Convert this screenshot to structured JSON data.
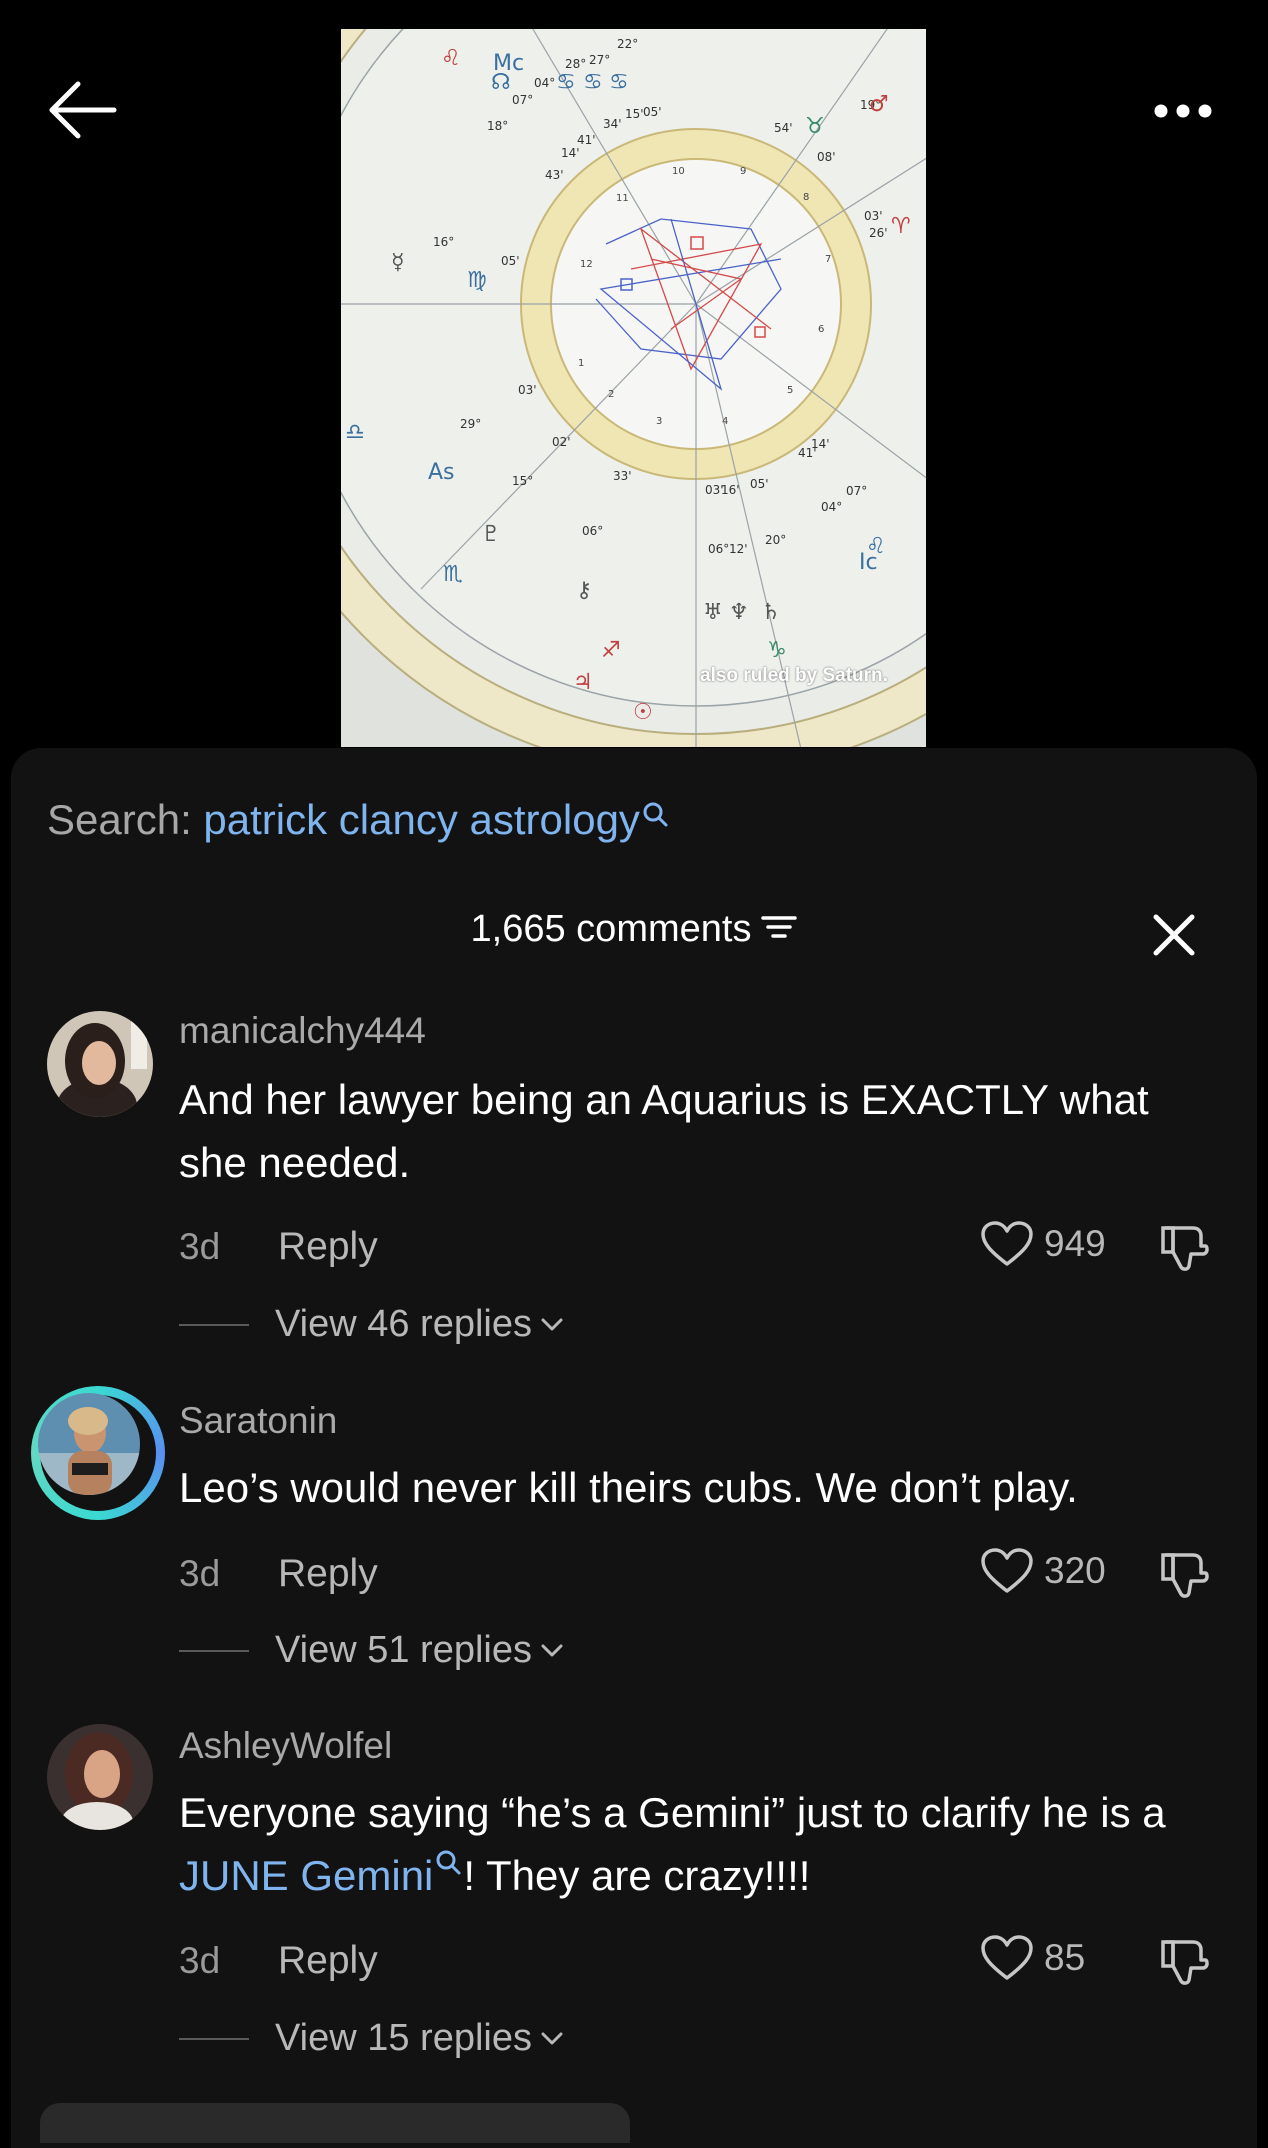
{
  "video": {
    "caption": "also ruled by Saturn.",
    "chart_degree_labels": [
      "28°",
      "27°",
      "22°",
      "04°",
      "07°",
      "18°",
      "34'",
      "15'",
      "05'",
      "41'",
      "14'",
      "43'",
      "16°",
      "05'",
      "03'",
      "29°",
      "02'",
      "15°",
      "33'",
      "06°",
      "03'",
      "16'",
      "05'",
      "06°",
      "12'",
      "20°",
      "54'",
      "08'",
      "19°",
      "03'",
      "26'",
      "14'",
      "41'",
      "07°",
      "04°"
    ],
    "house_numbers": [
      "1",
      "2",
      "3",
      "4",
      "5",
      "6",
      "7",
      "8",
      "9",
      "10",
      "11",
      "12"
    ]
  },
  "search": {
    "prefix": "Search:",
    "query": "patrick clancy astrology"
  },
  "comments_header": {
    "count_label": "1,665 comments"
  },
  "comments": [
    {
      "username": "manicalchy444",
      "text": "And her lawyer being an Aquarius is EXACTLY what she needed.",
      "age": "3d",
      "reply_label": "Reply",
      "likes": "949",
      "view_replies": "View 46 replies"
    },
    {
      "username": "Saratonin",
      "text": "Leo’s would never kill theirs cubs. We don’t play.",
      "age": "3d",
      "reply_label": "Reply",
      "likes": "320",
      "view_replies": "View 51 replies"
    },
    {
      "username": "AshleyWolfel",
      "text_before": "Everyone saying “he’s a Gemini” just to clarify he is a ",
      "text_link": "JUNE Gemini",
      "text_after": "! They are crazy!!!!",
      "age": "3d",
      "reply_label": "Reply",
      "likes": "85",
      "view_replies": "View 15 replies"
    }
  ],
  "colors": {
    "background": "#000000",
    "sheet": "#121212",
    "link": "#7fb4ef",
    "muted": "#a9a9a9"
  }
}
